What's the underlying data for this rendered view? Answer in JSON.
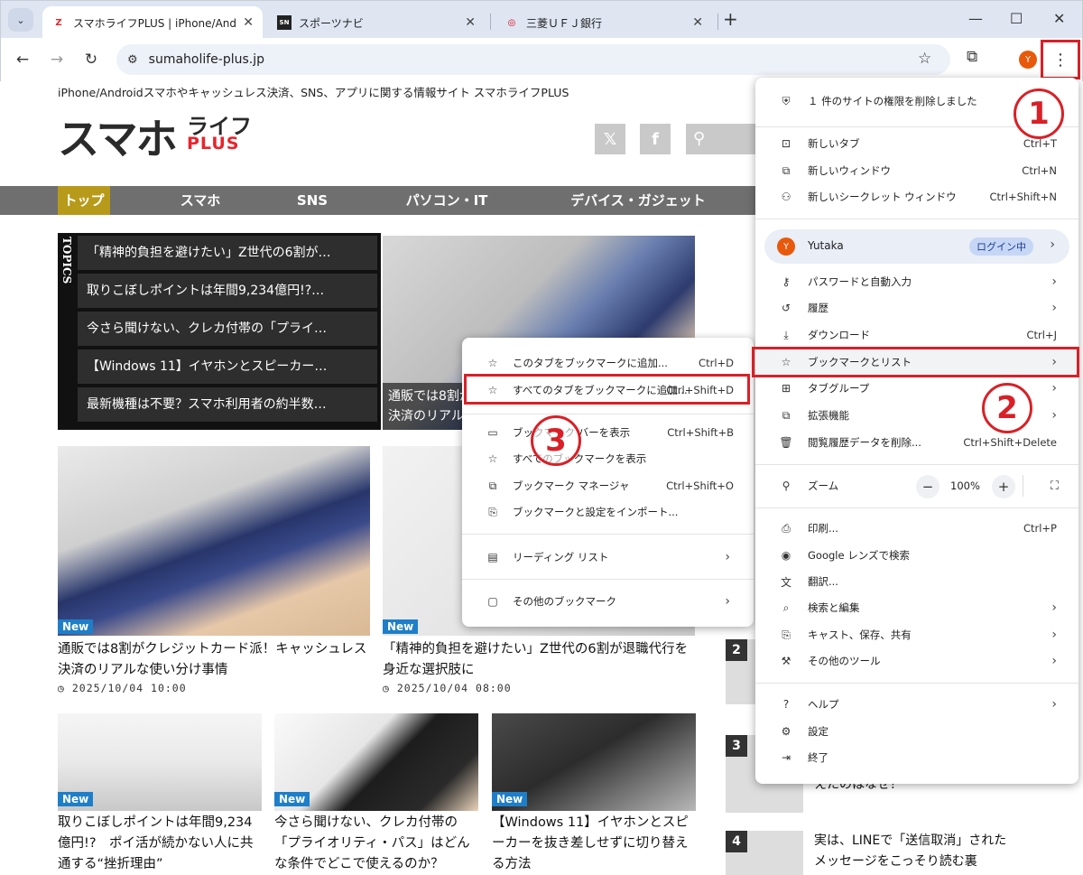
{
  "tabs": [
    {
      "title": "スマホライフPLUS | iPhone/Andro",
      "favicon": "スマ",
      "active": true
    },
    {
      "title": "スポーツナビ",
      "favicon": "SN",
      "active": false
    },
    {
      "title": "三菱ＵＦＪ銀行",
      "favicon": "◎",
      "active": false
    }
  ],
  "toolbar": {
    "url": "sumaholife-plus.jp",
    "avatar_letter": "Y"
  },
  "site": {
    "tagline": "iPhone/Androidスマホやキャッシュレス決済、SNS、アプリに関する情報サイト スマホライフPLUS",
    "logo_main": "スマホ",
    "logo_sub": "ライフ",
    "logo_plus": "PLUS",
    "nav": [
      "トップ",
      "スマホ",
      "SNS",
      "パソコン・IT",
      "デバイス・ガジェット"
    ],
    "topics_label": "TOPICS",
    "topics": [
      "「精神的負担を避けたい」Z世代の6割が…",
      "取りこぼしポイントは年間9,234億円!?…",
      "今さら聞けない、クレカ付帯の「プライ…",
      "【Windows 11】イヤホンとスピーカー…",
      "最新機種は不要？スマホ利用者の約半数…"
    ],
    "hero_caption": "通販では8割がクレジットカード派！キャッシュレス決済のリアルな使い分け事情",
    "new_label": "New",
    "cards_row1": [
      {
        "title": "通販では8割がクレジットカード派！キャッシュレス決済のリアルな使い分け事情",
        "date": "2025/10/04 10:00"
      },
      {
        "title": "「精神的負担を避けたい」Z世代の6割が退職代行を身近な選択肢に",
        "date": "2025/10/04 08:00"
      }
    ],
    "cards_row2": [
      {
        "title": "取りこぼしポイントは年間9,234億円!?　ポイ活が続かない人に共通する“挫折理由”"
      },
      {
        "title": "今さら聞けない、クレカ付帯の「プライオリティ・パス」はどんな条件でどこで使えるのか？"
      },
      {
        "title": "【Windows 11】イヤホンとスピーカーを抜き差しせずに切り替える方法"
      }
    ],
    "ranking": [
      {
        "no": "2",
        "text": ""
      },
      {
        "no": "3",
        "text": "えたのはなぜ？"
      },
      {
        "no": "4",
        "text": "実は、LINEで「送信取消」されたメッセージをこっそり読む裏"
      }
    ]
  },
  "bookmark_menu": {
    "items": [
      {
        "icon": "☆",
        "label": "このタブをブックマークに追加...",
        "shortcut": "Ctrl+D"
      },
      {
        "icon": "☆",
        "label": "すべてのタブをブックマークに追加...",
        "shortcut": "Ctrl+Shift+D"
      },
      {
        "icon": "▭",
        "label": "ブックマーク バーを表示",
        "shortcut": "Ctrl+Shift+B"
      },
      {
        "icon": "☆",
        "label": "すべてのブックマークを表示",
        "shortcut": ""
      },
      {
        "icon": "⧉",
        "label": "ブックマーク マネージャ",
        "shortcut": "Ctrl+Shift+O"
      },
      {
        "icon": "⎘",
        "label": "ブックマークと設定をインポート...",
        "shortcut": ""
      },
      {
        "icon": "▤",
        "label": "リーディング リスト",
        "shortcut": ""
      },
      {
        "icon": "▢",
        "label": "その他のブックマーク",
        "shortcut": ""
      }
    ]
  },
  "main_menu": {
    "notice": "１ 件のサイトの権限を削除しました",
    "items": {
      "new_tab": {
        "label": "新しいタブ",
        "shortcut": "Ctrl+T"
      },
      "new_window": {
        "label": "新しいウィンドウ",
        "shortcut": "Ctrl+N"
      },
      "incognito": {
        "label": "新しいシークレット ウィンドウ",
        "shortcut": "Ctrl+Shift+N"
      },
      "passwords": {
        "label": "パスワードと自動入力"
      },
      "history": {
        "label": "履歴"
      },
      "downloads": {
        "label": "ダウンロード",
        "shortcut": "Ctrl+J"
      },
      "bookmarks": {
        "label": "ブックマークとリスト"
      },
      "tab_groups": {
        "label": "タブグループ"
      },
      "extensions": {
        "label": "拡張機能"
      },
      "clear_data": {
        "label": "閲覧履歴データを削除...",
        "shortcut": "Ctrl+Shift+Delete"
      },
      "zoom": {
        "label": "ズーム",
        "value": "100%"
      },
      "print": {
        "label": "印刷...",
        "shortcut": "Ctrl+P"
      },
      "lens": {
        "label": "Google レンズで検索"
      },
      "translate": {
        "label": "翻訳..."
      },
      "find": {
        "label": "検索と編集"
      },
      "cast": {
        "label": "キャスト、保存、共有"
      },
      "more_tools": {
        "label": "その他のツール"
      },
      "help": {
        "label": "ヘルプ"
      },
      "settings": {
        "label": "設定"
      },
      "exit": {
        "label": "終了"
      }
    },
    "profile": {
      "letter": "Y",
      "name": "Yutaka",
      "status": "ログイン中"
    }
  },
  "annotations": {
    "step1": "1",
    "step2": "2",
    "step3": "3"
  },
  "colors": {
    "highlight": "#d92027",
    "nav_bg": "#6f6f6f",
    "nav_active": "#b89a1b",
    "new_badge": "#1e7fc8"
  }
}
